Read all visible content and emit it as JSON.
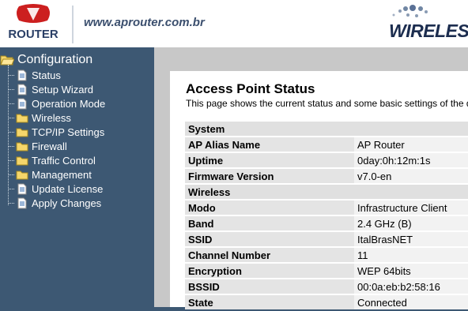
{
  "header": {
    "logo_text": "ROUTER",
    "url": "www.aprouter.com.br",
    "brand": "WIRELESS"
  },
  "sidebar": {
    "root": "Configuration",
    "items": [
      {
        "label": "Status",
        "icon": "page-icon"
      },
      {
        "label": "Setup Wizard",
        "icon": "page-icon"
      },
      {
        "label": "Operation Mode",
        "icon": "page-icon"
      },
      {
        "label": "Wireless",
        "icon": "folder-icon"
      },
      {
        "label": "TCP/IP Settings",
        "icon": "folder-icon"
      },
      {
        "label": "Firewall",
        "icon": "folder-icon"
      },
      {
        "label": "Traffic Control",
        "icon": "folder-icon"
      },
      {
        "label": "Management",
        "icon": "folder-icon"
      },
      {
        "label": "Update License",
        "icon": "page-icon"
      },
      {
        "label": "Apply Changes",
        "icon": "page-icon"
      }
    ]
  },
  "main": {
    "title": "Access Point Status",
    "description": "This page shows the current status and some basic settings of the device.",
    "sections": [
      {
        "name": "System",
        "rows": [
          {
            "key": "AP Alias Name",
            "value": "AP Router"
          },
          {
            "key": "Uptime",
            "value": "0day:0h:12m:1s"
          },
          {
            "key": "Firmware Version",
            "value": "v7.0-en"
          }
        ]
      },
      {
        "name": "Wireless",
        "rows": [
          {
            "key": "Modo",
            "value": "Infrastructure Client"
          },
          {
            "key": "Band",
            "value": "2.4 GHz (B)"
          },
          {
            "key": "SSID",
            "value": "ItalBrasNET"
          },
          {
            "key": "Channel Number",
            "value": "11"
          },
          {
            "key": "Encryption",
            "value": "WEP 64bits"
          },
          {
            "key": "BSSID",
            "value": "00:0a:eb:b2:58:16"
          },
          {
            "key": "State",
            "value": "Connected"
          }
        ]
      }
    ]
  },
  "colors": {
    "sidebar_bg": "#3d5873",
    "content_bg": "#c8c8c8",
    "logo_red": "#cc1f1f",
    "brand_navy": "#1c2d4f"
  }
}
